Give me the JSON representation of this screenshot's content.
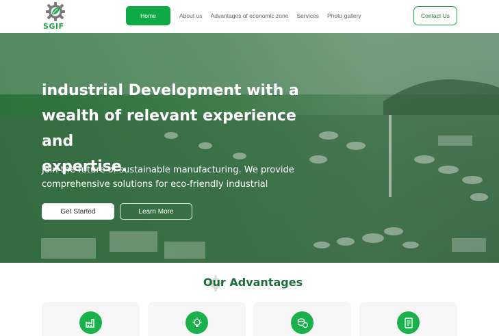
{
  "brand": {
    "name": "SGIF"
  },
  "nav": {
    "home": "Home",
    "links": [
      "About us",
      "Advantages of economic zone",
      "Services",
      "Photo gallery"
    ],
    "contact": "Contact Us"
  },
  "hero": {
    "title_lines": [
      "industrial Development with a",
      "wealth of relevant  experience and",
      "expertise."
    ],
    "subtitle_lines": [
      "Join the future of sustainable manufacturing. We provide",
      "comprehensive solutions for eco-friendly industrial"
    ],
    "primary_button": "Get Started",
    "secondary_button": "Learn More"
  },
  "advantages": {
    "title": "Our Advantages",
    "cards": [
      {
        "icon": "factory-icon"
      },
      {
        "icon": "lightbulb-icon"
      },
      {
        "icon": "coins-icon"
      },
      {
        "icon": "document-icon"
      }
    ]
  },
  "colors": {
    "accent": "#0daa45",
    "heading": "#1d6b3a"
  }
}
